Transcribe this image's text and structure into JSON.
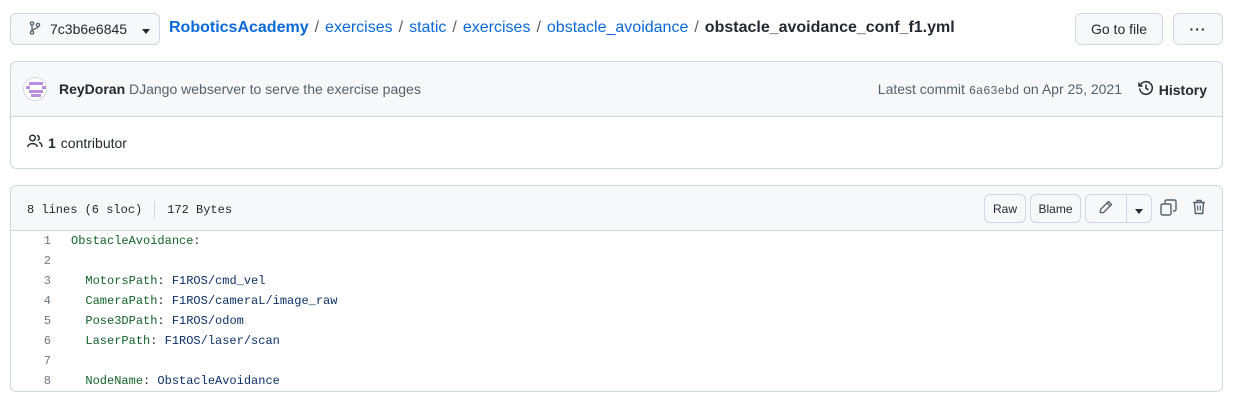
{
  "branch": {
    "name": "7c3b6e6845"
  },
  "breadcrumb": {
    "repo": "RoboticsAcademy",
    "segments": [
      "exercises",
      "static",
      "exercises",
      "obstacle_avoidance"
    ],
    "file": "obstacle_avoidance_conf_f1.yml",
    "separator": "/"
  },
  "actions": {
    "goto_file": "Go to file",
    "more": "···"
  },
  "commit": {
    "author": "ReyDoran",
    "message": "DJango webserver to serve the exercise pages",
    "latest_label": "Latest commit",
    "sha": "6a63ebd",
    "date_text": "on Apr 25, 2021",
    "history_label": "History"
  },
  "contributors": {
    "count": "1",
    "label": "contributor"
  },
  "file": {
    "lines_info": "8 lines (6 sloc)",
    "size": "172 Bytes",
    "raw_label": "Raw",
    "blame_label": "Blame"
  },
  "code_lines": [
    {
      "n": "1",
      "key": "ObstacleAvoidance",
      "sep": ":",
      "val": "",
      "indent": ""
    },
    {
      "n": "2",
      "key": "",
      "sep": "",
      "val": "",
      "indent": ""
    },
    {
      "n": "3",
      "key": "MotorsPath",
      "sep": ": ",
      "val": "F1ROS/cmd_vel",
      "indent": "  "
    },
    {
      "n": "4",
      "key": "CameraPath",
      "sep": ": ",
      "val": "F1ROS/cameraL/image_raw",
      "indent": "  "
    },
    {
      "n": "5",
      "key": "Pose3DPath",
      "sep": ": ",
      "val": "F1ROS/odom",
      "indent": "  "
    },
    {
      "n": "6",
      "key": "LaserPath",
      "sep": ": ",
      "val": "F1ROS/laser/scan",
      "indent": "  "
    },
    {
      "n": "7",
      "key": "",
      "sep": "",
      "val": "",
      "indent": ""
    },
    {
      "n": "8",
      "key": "NodeName",
      "sep": ": ",
      "val": "ObstacleAvoidance",
      "indent": "  "
    }
  ],
  "colors": {
    "link": "#0969da",
    "border": "#d0d7de",
    "header_bg": "#f6f8fa",
    "yaml_key": "#116329",
    "yaml_value": "#0a3069"
  },
  "icons": [
    "branch-icon",
    "chevron-down-icon",
    "history-icon",
    "people-icon",
    "pencil-icon",
    "copy-icon",
    "trash-icon"
  ]
}
